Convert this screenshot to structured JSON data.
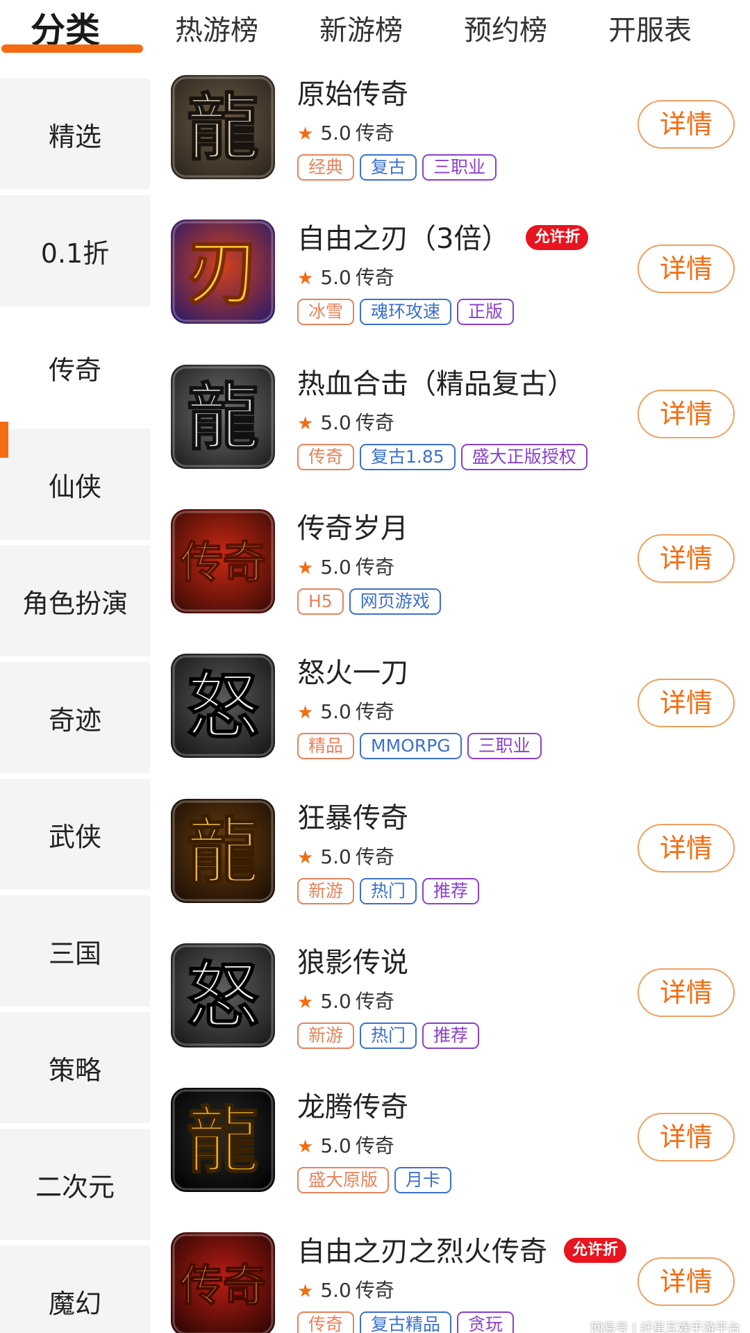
{
  "tabs": [
    {
      "label": "分类"
    },
    {
      "label": "热游榜"
    },
    {
      "label": "新游榜"
    },
    {
      "label": "预约榜"
    },
    {
      "label": "开服表"
    }
  ],
  "sidebar": {
    "items": [
      {
        "label": "精选"
      },
      {
        "label": "0.1折"
      },
      {
        "label": "传奇"
      },
      {
        "label": "仙侠"
      },
      {
        "label": "角色扮演"
      },
      {
        "label": "奇迹"
      },
      {
        "label": "武侠"
      },
      {
        "label": "三国"
      },
      {
        "label": "策略"
      },
      {
        "label": "二次元"
      },
      {
        "label": "魔幻"
      }
    ],
    "active_index": 2
  },
  "colors": {
    "accent": "#f46c12",
    "badge_red": "#e8141f",
    "tag_orange": "#e8825a",
    "tag_blue": "#3b6fd0",
    "tag_purple": "#8a3fd0"
  },
  "detail_label": "详情",
  "games": [
    {
      "name": "原始传奇",
      "icon": "dragon-char-icon",
      "rating": "5.0",
      "genre": "传奇",
      "badge": "",
      "tags": [
        "经典",
        "复古",
        "三职业"
      ]
    },
    {
      "name": "自由之刃（3倍）",
      "icon": "blade-char-icon",
      "rating": "5.0",
      "genre": "传奇",
      "badge": "允许折",
      "tags": [
        "冰雪",
        "魂环攻速",
        "正版"
      ]
    },
    {
      "name": "热血合击（精品复古）",
      "icon": "dragon-metal-icon",
      "rating": "5.0",
      "genre": "传奇",
      "badge": "",
      "tags": [
        "传奇",
        "复古1.85",
        "盛大正版授权"
      ]
    },
    {
      "name": "传奇岁月",
      "icon": "legend-fire-icon",
      "rating": "5.0",
      "genre": "传奇",
      "badge": "",
      "tags": [
        "H5",
        "网页游戏"
      ]
    },
    {
      "name": "怒火一刀",
      "icon": "anger-char-icon",
      "rating": "5.0",
      "genre": "传奇",
      "badge": "",
      "tags": [
        "精品",
        "MMORPG",
        "三职业"
      ]
    },
    {
      "name": "狂暴传奇",
      "icon": "gold-dragon-icon",
      "rating": "5.0",
      "genre": "传奇",
      "badge": "",
      "tags": [
        "新游",
        "热门",
        "推荐"
      ]
    },
    {
      "name": "狼影传说",
      "icon": "anger-speed-icon",
      "rating": "5.0",
      "genre": "传奇",
      "badge": "",
      "tags": [
        "新游",
        "热门",
        "推荐"
      ]
    },
    {
      "name": "龙腾传奇",
      "icon": "gold-dragon-orb-icon",
      "rating": "5.0",
      "genre": "传奇",
      "badge": "",
      "tags": [
        "盛大原版",
        "月卡"
      ]
    },
    {
      "name": "自由之刃之烈火传奇",
      "icon": "legend-super-icon",
      "rating": "5.0",
      "genre": "传奇",
      "badge": "允许折",
      "tags": [
        "传奇",
        "复古精品",
        "贪玩"
      ]
    }
  ],
  "watermark": "网易号 | 纤星互娱手游平台"
}
